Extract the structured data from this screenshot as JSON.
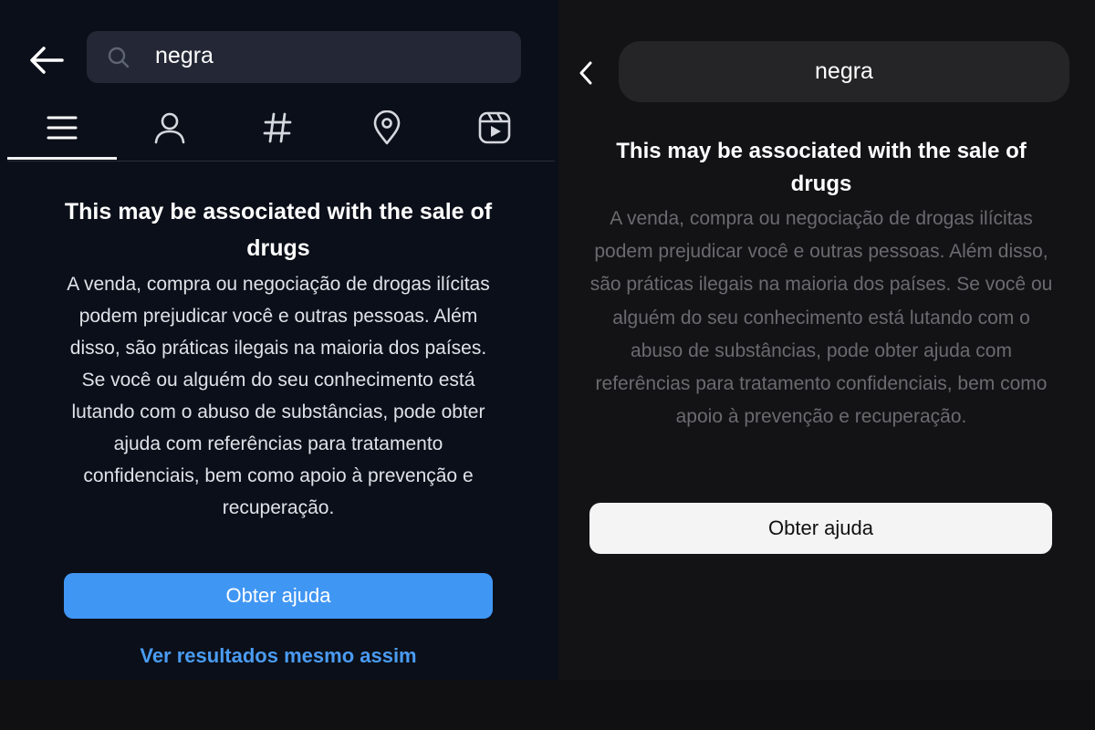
{
  "left": {
    "search": {
      "query": "negra"
    },
    "tabs": [
      {
        "icon": "menu-icon",
        "active": true
      },
      {
        "icon": "person-icon",
        "active": false
      },
      {
        "icon": "hashtag-icon",
        "active": false
      },
      {
        "icon": "location-pin-icon",
        "active": false
      },
      {
        "icon": "reels-icon",
        "active": false
      }
    ],
    "warning": {
      "title": "This may be associated with the sale of drugs",
      "body": "A venda, compra ou negociação de drogas ilícitas podem prejudicar você e outras pessoas. Além disso, são práticas ilegais na maioria dos países. Se você ou alguém do seu conhecimento está lutando com o abuso de substâncias, pode obter ajuda com referências para tratamento confidenciais, bem como apoio à prevenção e recuperação."
    },
    "help_button": "Obter ajuda",
    "see_results_link": "Ver resultados mesmo assim",
    "colors": {
      "background": "#0b0f19",
      "accent": "#4096f3",
      "link": "#4a9bf2"
    }
  },
  "right": {
    "search": {
      "query": "negra"
    },
    "warning": {
      "title": "This may be associated with the sale of drugs",
      "body": "A venda, compra ou negociação de drogas ilícitas podem prejudicar você e outras pessoas. Além disso, são práticas ilegais na maioria dos países. Se você ou alguém do seu conhecimento está lutando com o abuso de substâncias, pode obter ajuda com referências para tratamento confidenciais, bem como apoio à prevenção e recuperação."
    },
    "help_button": "Obter ajuda",
    "colors": {
      "background": "#131315",
      "button": "#f4f4f5"
    }
  }
}
